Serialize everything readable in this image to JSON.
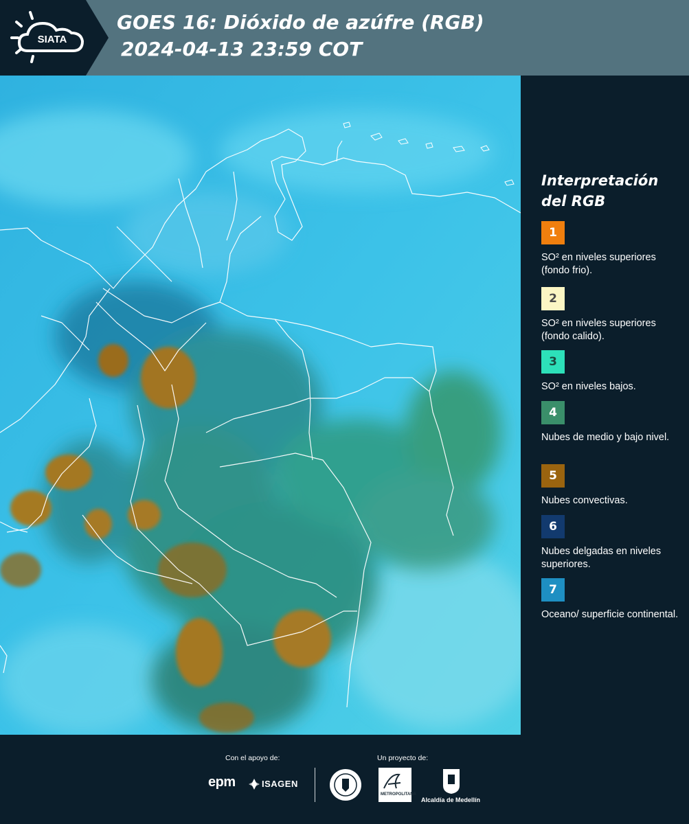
{
  "header": {
    "logo_text": "SIATA",
    "title_line1": "GOES 16: Dióxido de azúfre (RGB)",
    "title_line2": "2024-04-13 23:59 COT"
  },
  "legend": {
    "title": "Interpretación del RGB",
    "items": [
      {
        "number": "1",
        "label": "SO² en niveles superiores (fondo frio).",
        "color": "#f07f0e",
        "text_color": "#ffffff"
      },
      {
        "number": "2",
        "label": "SO² en niveles superiores (fondo calido).",
        "color": "#fbf6c4",
        "text_color": "#4a4a4a"
      },
      {
        "number": "3",
        "label": "SO² en niveles bajos.",
        "color": "#2de0b9",
        "text_color": "#1a4a40"
      },
      {
        "number": "4",
        "label": "Nubes de medio y bajo nivel.",
        "color": "#3a8f6a",
        "text_color": "#ffffff"
      },
      {
        "number": "5",
        "label": "Nubes convectivas.",
        "color": "#9a640f",
        "text_color": "#ffffff"
      },
      {
        "number": "6",
        "label": "Nubes delgadas en niveles superiores.",
        "color": "#123a6e",
        "text_color": "#ffffff"
      },
      {
        "number": "7",
        "label": "Oceano/ superficie continental.",
        "color": "#1e8fc2",
        "text_color": "#ffffff"
      }
    ]
  },
  "footer": {
    "support_caption": "Con el apoyo de:",
    "project_caption": "Un proyecto de:",
    "sponsor_1": "epm",
    "sponsor_2": "ISAGEN",
    "partner_1": "METROPOLITANA",
    "partner_2": "Alcaldía de Medellín"
  }
}
